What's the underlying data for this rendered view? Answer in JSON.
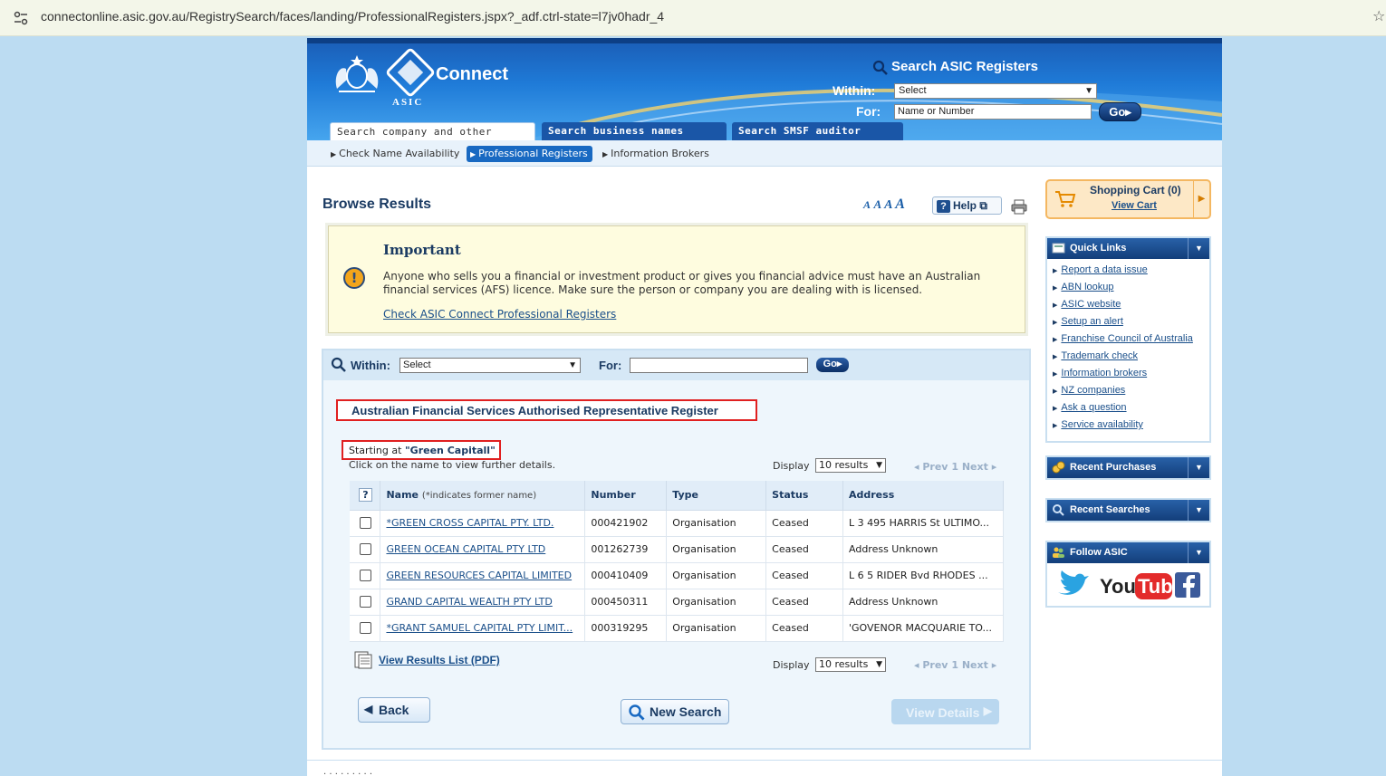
{
  "browser": {
    "url": "connectonline.asic.gov.au/RegistrySearch/faces/landing/ProfessionalRegisters.jspx?_adf.ctrl-state=l7jv0hadr_4"
  },
  "header": {
    "brand": "Connect",
    "asic_label": "ASIC",
    "search_title": "Search ASIC Registers",
    "within_label": "Within:",
    "within_value": "Select",
    "for_label": "For:",
    "for_placeholder": "Name or Number",
    "go_label": "Go",
    "tabs": [
      {
        "label": "Search company and other registers",
        "active": true
      },
      {
        "label": "Search business names register",
        "active": false
      },
      {
        "label": "Search SMSF auditor register",
        "active": false
      }
    ]
  },
  "subnav": {
    "items": [
      "Check Name Availability",
      "Professional Registers",
      "Information Brokers"
    ],
    "active": "Professional Registers"
  },
  "main": {
    "title": "Browse Results",
    "font_sizes": "A A A A",
    "help_label": "Help",
    "important": {
      "title": "Important",
      "body": "Anyone who sells you a financial or investment product or gives you financial advice must have an Australian financial services (AFS) licence. Make sure the person or company you are dealing with is licensed.",
      "link": "Check ASIC Connect Professional Registers"
    },
    "search": {
      "within_label": "Within:",
      "within_value": "Select",
      "for_label": "For:",
      "go_label": "Go"
    },
    "register_title": "Australian Financial Services Authorised Representative Register",
    "starting_prefix": "Starting at",
    "starting_value": "\"Green Capitall\"",
    "click_hint": "Click on the name to view further details.",
    "display_label": "Display",
    "display_value": "10 results",
    "pager": {
      "prev": "Prev",
      "page": "1",
      "next": "Next"
    },
    "table": {
      "headers": {
        "name": "Name",
        "name_note": "(*indicates former name)",
        "number": "Number",
        "type": "Type",
        "status": "Status",
        "address": "Address"
      },
      "rows": [
        {
          "name": "*GREEN CROSS CAPITAL PTY. LTD.",
          "number": "000421902",
          "type": "Organisation",
          "status": "Ceased",
          "address": "L 3 495 HARRIS St ULTIMO..."
        },
        {
          "name": "GREEN OCEAN CAPITAL PTY LTD",
          "number": "001262739",
          "type": "Organisation",
          "status": "Ceased",
          "address": "Address Unknown"
        },
        {
          "name": "GREEN RESOURCES CAPITAL LIMITED",
          "number": "000410409",
          "type": "Organisation",
          "status": "Ceased",
          "address": "L 6 5 RIDER Bvd RHODES ..."
        },
        {
          "name": "GRAND CAPITAL WEALTH PTY LTD",
          "number": "000450311",
          "type": "Organisation",
          "status": "Ceased",
          "address": "Address Unknown"
        },
        {
          "name": "*GRANT SAMUEL CAPITAL PTY LIMIT...",
          "number": "000319295",
          "type": "Organisation",
          "status": "Ceased",
          "address": "'GOVENOR MACQUARIE TO..."
        }
      ]
    },
    "pdf_link": "View Results List (PDF)",
    "buttons": {
      "back": "Back",
      "new_search": "New Search",
      "view_details": "View Details"
    }
  },
  "sidebar": {
    "cart_title": "Shopping Cart (0)",
    "cart_link": "View Cart",
    "quick_links_title": "Quick Links",
    "quick_links": [
      "Report a data issue",
      "ABN lookup",
      "ASIC website",
      "Setup an alert",
      "Franchise Council of Australia",
      "Trademark check",
      "Information brokers",
      "NZ companies",
      "Ask a question",
      "Service availability"
    ],
    "recent_purchases": "Recent Purchases",
    "recent_searches": "Recent Searches",
    "follow": "Follow ASIC"
  },
  "colors": {
    "accent": "#1a56a7",
    "highlight_box": "#e02020",
    "page_bg": "#bcdcf2"
  }
}
